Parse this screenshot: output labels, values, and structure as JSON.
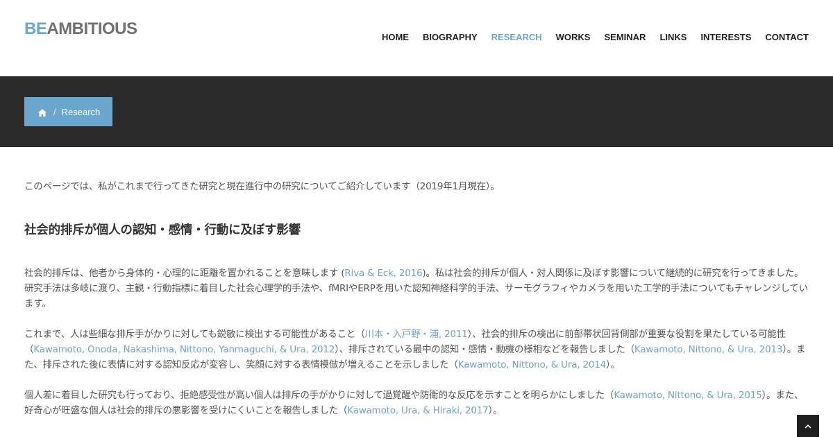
{
  "header": {
    "logo_prefix": "BE",
    "logo_rest": "AMBITIOUS",
    "nav": [
      "HOME",
      "BIOGRAPHY",
      "RESEARCH",
      "WORKS",
      "SEMINAR",
      "LINKS",
      "INTERESTS",
      "CONTACT"
    ],
    "active_nav": "RESEARCH"
  },
  "breadcrumb": {
    "home_icon": "home-icon",
    "separator": "/",
    "current": "Research"
  },
  "content": {
    "intro": "このページでは、私がこれまで行ってきた研究と現在進行中の研究についてご紹介しています（2019年1月現在）。",
    "section_title": "社会的排斥が個人の認知・感情・行動に及ぼす影響",
    "p1": {
      "t1": "社会的排斥は、他者から身体的・心理的に距離を置かれることを意味します (",
      "l1": "Riva & Eck, 2016",
      "t2": ")。私は社会的排斥が個人・対人関係に及ぼす影響について継続的に研究を行ってきました。研究手法は多岐に渡り、主観・行動指標に着目した社会心理学的手法や、fMRIやERPを用いた認知神経科学的手法、サーモグラフィやカメラを用いた工学的手法についてもチャレンジしています。"
    },
    "p2": {
      "t1": "これまで、人は些細な排斥手がかりに対しても鋭敏に検出する可能性があること（",
      "l1": "川本・入戸野・浦, 2011",
      "t2": "）、社会的排斥の検出に前部帯状回背側部が重要な役割を果たしている可能性（",
      "l2": "Kawamoto, Onoda, Nakashima, Nittono, Yanmaguchi, & Ura, 2012",
      "t3": "）、排斥されている最中の認知・感情・動機の様相などを報告しました（",
      "l3": "Kawamoto, Nittono, & Ura, 2013",
      "t4": "）。また、排斥された後に表情に対する認知反応が変容し、笑顔に対する表情模倣が増えることを示しました（",
      "l4": "Kawamoto, Nittono, & Ura, 2014",
      "t5": "）。"
    },
    "p3": {
      "t1": "個人差に着目した研究も行っており、拒絶感受性が高い個人は排斥の手がかりに対して過覚醒や防衛的な反応を示すことを明らかにしました（",
      "l1": "Kawamoto, Nittono, & Ura, 2015",
      "t2": "）。また、好奇心が旺盛な個人は社会的排斥の悪影響を受けにくいことを報告しました（",
      "l2": "Kawamoto, Ura, & Hiraki, 2017",
      "t3": "）。"
    }
  },
  "back_to_top_icon": "chevron-up-icon",
  "colors": {
    "accent": "#6aa6cd",
    "banner": "#2b2b2b",
    "text": "#555555"
  }
}
